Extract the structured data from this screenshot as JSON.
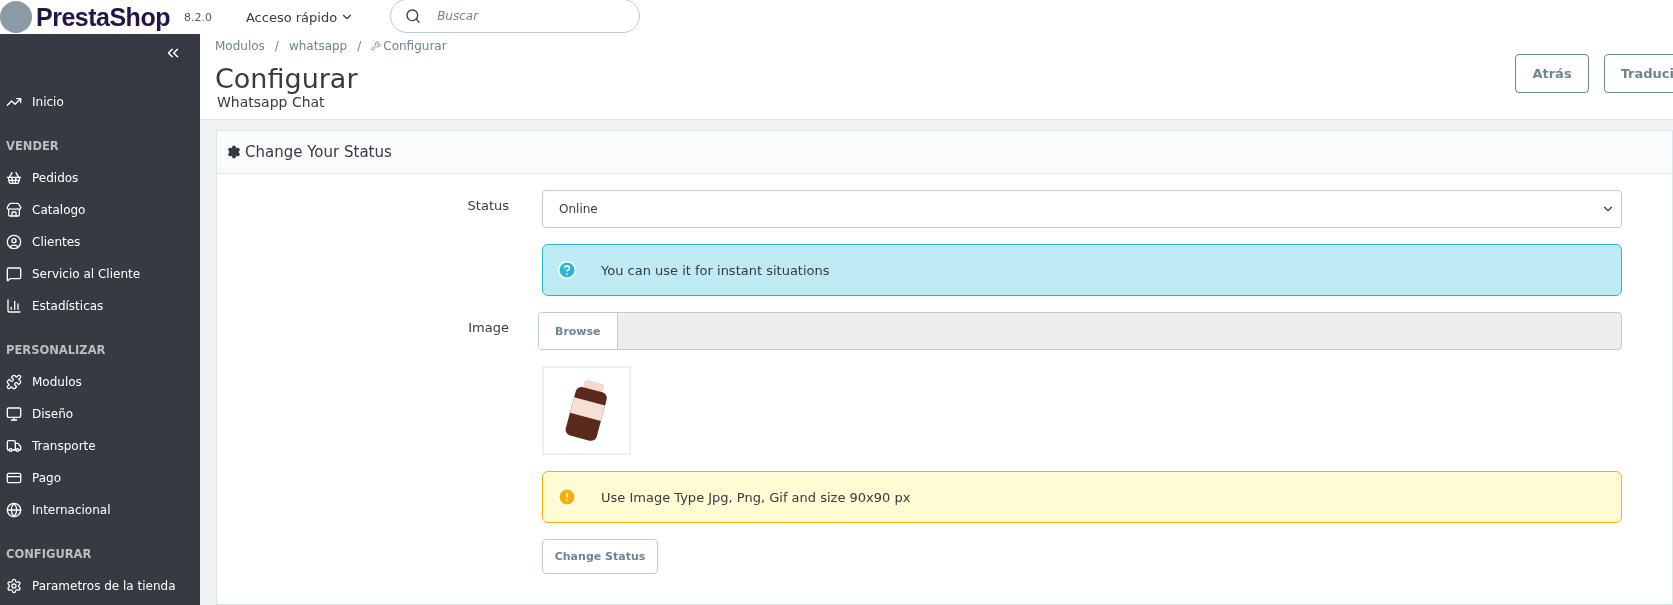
{
  "header": {
    "logo": "PrestaShop",
    "version": "8.2.0",
    "quick_access": "Acceso rápido",
    "search": {
      "placeholder": "Buscar"
    }
  },
  "sidebar": {
    "items": [
      {
        "kind": "item",
        "label": "Inicio"
      },
      {
        "kind": "section",
        "label": "VENDER"
      },
      {
        "kind": "item",
        "label": "Pedidos"
      },
      {
        "kind": "item",
        "label": "Catalogo"
      },
      {
        "kind": "item",
        "label": "Clientes"
      },
      {
        "kind": "item",
        "label": "Servicio al Cliente"
      },
      {
        "kind": "item",
        "label": "Estadísticas"
      },
      {
        "kind": "section",
        "label": "PERSONALIZAR"
      },
      {
        "kind": "item",
        "label": "Modulos"
      },
      {
        "kind": "item",
        "label": "Diseño"
      },
      {
        "kind": "item",
        "label": "Transporte"
      },
      {
        "kind": "item",
        "label": "Pago"
      },
      {
        "kind": "item",
        "label": "Internacional"
      },
      {
        "kind": "section",
        "label": "CONFIGURAR"
      },
      {
        "kind": "item",
        "label": "Parametros de la tienda"
      }
    ]
  },
  "breadcrumb": [
    {
      "kind": "link",
      "label": "Modulos"
    },
    {
      "kind": "separator",
      "label": "/"
    },
    {
      "kind": "link",
      "label": "whatsapp"
    },
    {
      "kind": "separator",
      "label": "/"
    },
    {
      "kind": "current",
      "label": "Configurar"
    }
  ],
  "page": {
    "title": "Configurar",
    "subtitle": "Whatsapp Chat",
    "buttons": [
      "Atrás",
      "Traduci"
    ]
  },
  "panel": {
    "title": "Change Your Status",
    "status": {
      "label": "Status",
      "value": "Online"
    },
    "info": "You can use it for instant situations",
    "image": {
      "label": "Image",
      "browse": "Browse"
    },
    "warning": "Use Image Type Jpg, Png, Gif and size 90x90 px",
    "submit": "Change Status"
  }
}
